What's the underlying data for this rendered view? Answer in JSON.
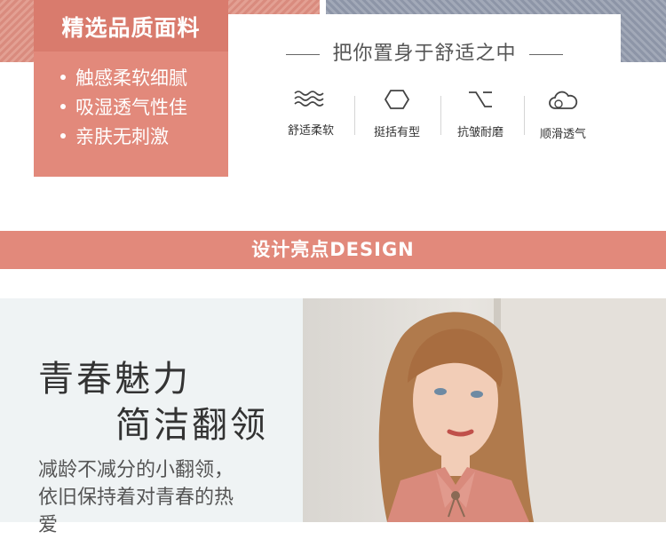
{
  "quality": {
    "title": "精选品质面料",
    "items": [
      "触感柔软细腻",
      "吸湿透气性佳",
      "亲肤无刺激"
    ]
  },
  "slogan": "把你置身于舒适之中",
  "features": [
    {
      "icon": "waves-icon",
      "label": "舒适柔软"
    },
    {
      "icon": "hexagon-icon",
      "label": "挺括有型"
    },
    {
      "icon": "option-key-icon",
      "label": "抗皱耐磨"
    },
    {
      "icon": "cloud-icon",
      "label": "顺滑透气"
    }
  ],
  "design_banner": "设计亮点DESIGN",
  "highlight": {
    "headline_1": "青春魅力",
    "headline_2": "简洁翻领",
    "desc_lines": [
      "减龄不减分的小翻领，",
      "依旧保持着对青春的热",
      "爱"
    ]
  },
  "colors": {
    "accent": "#e2897b",
    "accent_dark": "#d97b6d",
    "panel_bg": "#eff3f4"
  }
}
